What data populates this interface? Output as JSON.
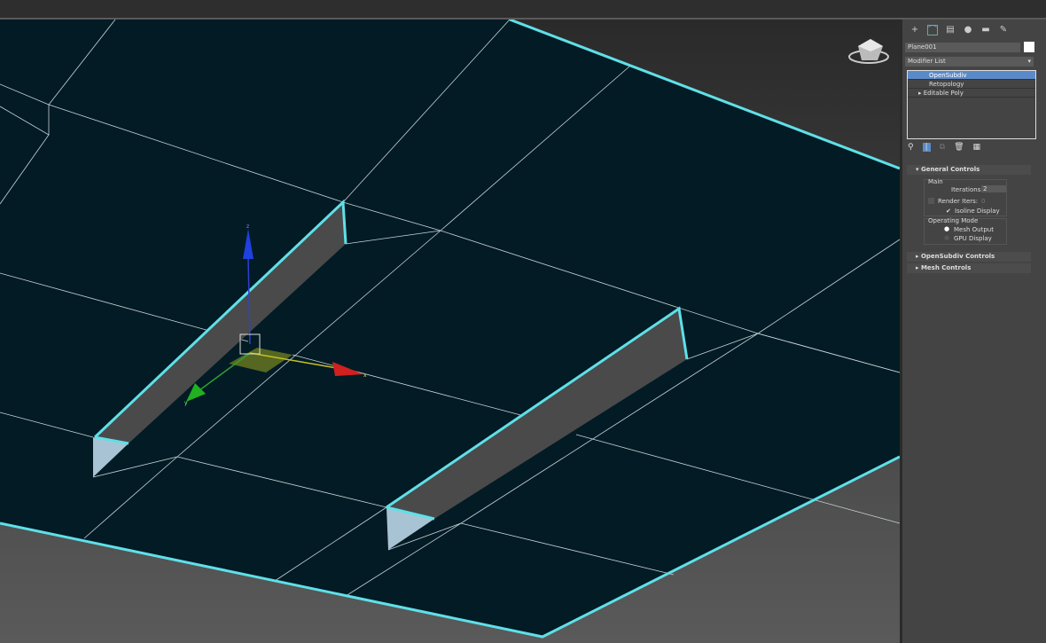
{
  "viewport": {
    "gizmo_x": "x",
    "gizmo_y": "y",
    "gizmo_z": "z"
  },
  "panel": {
    "tabs": [
      "create-icon",
      "modify-icon",
      "hierarchy-icon",
      "motion-icon",
      "display-icon",
      "utilities-icon"
    ],
    "object_name": "Plane001",
    "object_color": "#ffffff",
    "modifier_list": "Modifier List",
    "stack": [
      "OpenSubdiv",
      "Retopology",
      "Editable Poly"
    ],
    "general_controls": "General Controls",
    "main": "Main",
    "iterations_label": "Iterations:",
    "iterations_value": "2",
    "render_iters_label": "Render Iters:",
    "render_iters_value": "0",
    "isoline_label": "Isoline Display",
    "operating_mode": "Operating Mode",
    "mesh_output": "Mesh Output",
    "gpu_display": "GPU Display",
    "opensubdiv_controls": "OpenSubdiv Controls",
    "mesh_controls": "Mesh Controls"
  },
  "colors": {
    "edge": "#5fe0e8",
    "plane": "#021b25"
  }
}
